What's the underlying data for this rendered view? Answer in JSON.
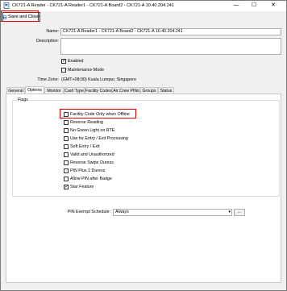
{
  "window": {
    "title": "CK721-A Reader  -  CK721-A Reader1 - CK721-A Board2 - CK721-A 10.40.204.241",
    "minimize_glyph": "—",
    "maximize_glyph": "☐",
    "close_glyph": "✕"
  },
  "toolbar": {
    "save_close_label": "Save and Close"
  },
  "form": {
    "name_label": "Name:",
    "name_value": "CK721-A Reader1 - CK721-A Board2 - CK721-A 10.40.204.241",
    "description_label": "Description:",
    "description_value": "",
    "enabled_label": "Enabled",
    "enabled_checked": true,
    "maintenance_label": "Maintenance Mode",
    "maintenance_checked": false,
    "timezone_label": "Time Zone:",
    "timezone_value": "(GMT+08:00) Kuala Lumpur, Singapore"
  },
  "tabs": [
    {
      "label": "General"
    },
    {
      "label": "Options"
    },
    {
      "label": "Monitor"
    },
    {
      "label": "Card Type"
    },
    {
      "label": "Facility Codes"
    },
    {
      "label": "Air Crew PINs"
    },
    {
      "label": "Groups"
    },
    {
      "label": "Status"
    }
  ],
  "active_tab": "Options",
  "flags": {
    "group_title": "Flags",
    "items": [
      {
        "label": "Facility Code Only when Offline",
        "checked": false
      },
      {
        "label": "Reverse Reading",
        "checked": false
      },
      {
        "label": "No Green Light on RTE",
        "checked": false
      },
      {
        "label": "Use for Entry / Exit Processing",
        "checked": false
      },
      {
        "label": "Soft Entry / Exit",
        "checked": false
      },
      {
        "label": "Valid and Unauthorized",
        "checked": false
      },
      {
        "label": "Reverse Swipe Duress",
        "checked": false
      },
      {
        "label": "PIN Plus 1 Duress",
        "checked": false
      },
      {
        "label": "Allow PIN after Badge",
        "checked": false
      },
      {
        "label": "Star Feature",
        "checked": true
      }
    ]
  },
  "pin_schedule": {
    "label": "PIN Exempt Schedule:",
    "value": "Always",
    "dropdown_glyph": "▾",
    "browse_label": "..."
  },
  "colors": {
    "highlight": "#e00000",
    "window_bg": "#f0f0f0"
  }
}
